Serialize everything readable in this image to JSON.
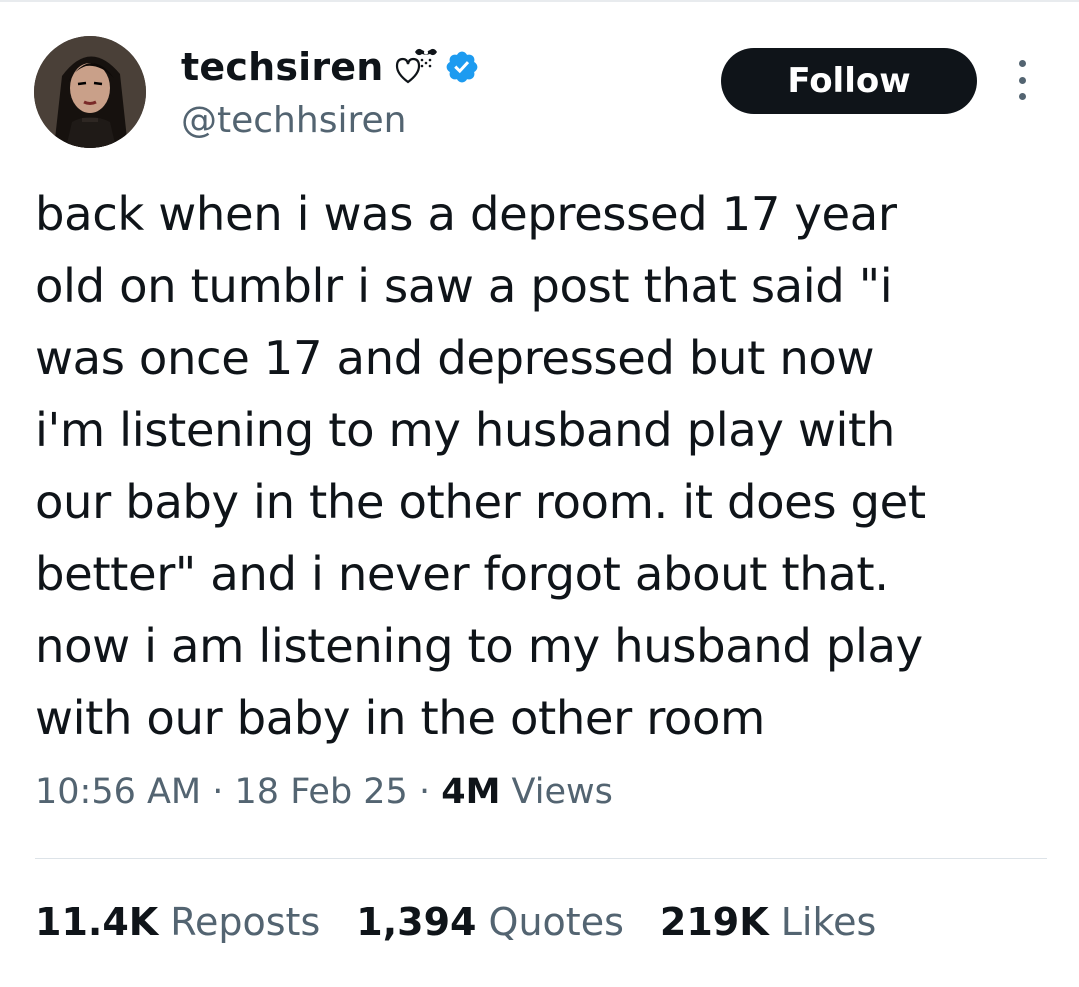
{
  "author": {
    "display_name": "techsiren",
    "handle": "@techhsiren",
    "verified": true,
    "decoration_icon": "heart-with-bow-icon",
    "verified_icon": "verified-badge-icon"
  },
  "header": {
    "follow_label": "Follow",
    "more_icon": "more-vertical-icon"
  },
  "tweet": {
    "lines": [
      "back when i was a depressed 17 year",
      "old on tumblr i saw a post that said \"i",
      "was once 17 and depressed but now",
      "i'm listening to my husband play with",
      "our baby in the other room. it does get",
      "better\" and i never forgot about that.",
      "now i am listening to my husband play",
      "with our baby in the other room"
    ]
  },
  "meta": {
    "time": "10:56 AM",
    "date": "18 Feb 25",
    "separator": " · ",
    "views_count": "4M",
    "views_label": "Views"
  },
  "stats": {
    "reposts": {
      "count": "11.4K",
      "label": "Reposts"
    },
    "quotes": {
      "count": "1,394",
      "label": "Quotes"
    },
    "likes": {
      "count": "219K",
      "label": "Likes"
    }
  },
  "colors": {
    "text": "#0f1419",
    "secondary": "#536471",
    "verified": "#1d9bf0",
    "button": "#0f1419"
  }
}
